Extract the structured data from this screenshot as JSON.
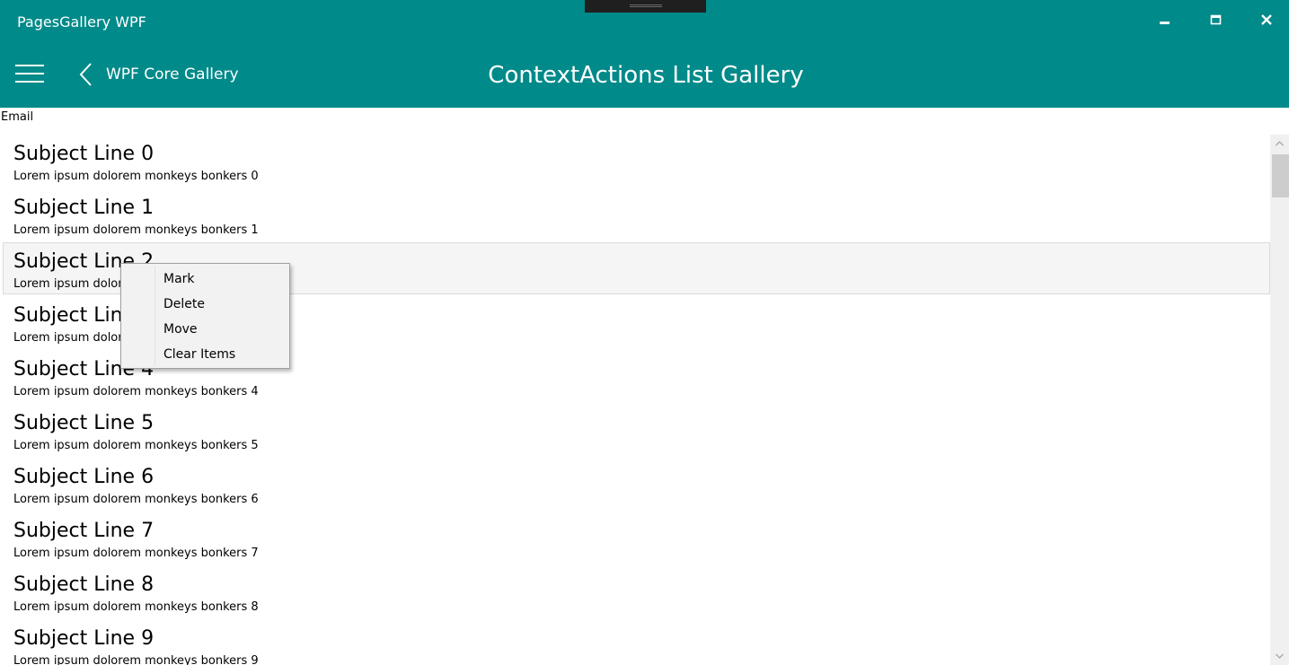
{
  "window": {
    "title": "PagesGallery WPF",
    "controls": {
      "minimize_icon": "minimize-icon",
      "maximize_icon": "maximize-icon",
      "close_icon": "close-icon"
    }
  },
  "header": {
    "menu_icon": "hamburger-menu-icon",
    "back_icon": "chevron-left-icon",
    "back_label": "WPF Core Gallery",
    "page_title": "ContextActions List Gallery",
    "color": "#008a89"
  },
  "content": {
    "section_label": "Email",
    "items": [
      {
        "subject": "Subject Line 0",
        "body": "Lorem ipsum dolorem monkeys bonkers 0"
      },
      {
        "subject": "Subject Line 1",
        "body": "Lorem ipsum dolorem monkeys bonkers 1"
      },
      {
        "subject": "Subject Line 2",
        "body": "Lorem ipsum dolorem monkeys bonkers 2",
        "selected": true
      },
      {
        "subject": "Subject Line 3",
        "body": "Lorem ipsum dolorem monkeys bonkers 3"
      },
      {
        "subject": "Subject Line 4",
        "body": "Lorem ipsum dolorem monkeys bonkers 4"
      },
      {
        "subject": "Subject Line 5",
        "body": "Lorem ipsum dolorem monkeys bonkers 5"
      },
      {
        "subject": "Subject Line 6",
        "body": "Lorem ipsum dolorem monkeys bonkers 6"
      },
      {
        "subject": "Subject Line 7",
        "body": "Lorem ipsum dolorem monkeys bonkers 7"
      },
      {
        "subject": "Subject Line 8",
        "body": "Lorem ipsum dolorem monkeys bonkers 8"
      },
      {
        "subject": "Subject Line 9",
        "body": "Lorem ipsum dolorem monkeys bonkers 9"
      }
    ]
  },
  "context_menu": {
    "items": [
      "Mark",
      "Delete",
      "Move",
      "Clear Items"
    ]
  },
  "scrollbar": {
    "up_icon": "chevron-up-icon",
    "down_icon": "chevron-down-icon"
  }
}
